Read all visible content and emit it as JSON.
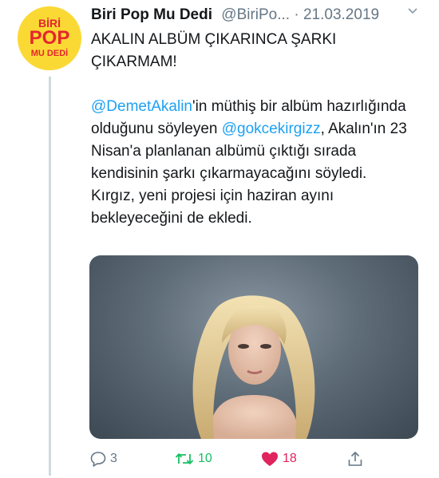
{
  "account": {
    "display_name": "Biri Pop Mu Dedi",
    "handle": "@BiriPo...",
    "separator": " · ",
    "date": "21.03.2019",
    "logo_lines": [
      "BİRİ",
      "POP",
      "MU DEDİ"
    ]
  },
  "tweet": {
    "headline": "AKALIN ALBÜM ÇIKARINCA ŞARKI ÇIKARMAM!",
    "mention1": "@DemetAkalin",
    "text1": "'in müthiş bir albüm hazırlığında olduğunu söyleyen ",
    "mention2": "@gokcekirgizz",
    "text2": ", Akalın'ın 23 Nisan'a planlanan albümü çıktığı sırada kendisinin şarkı çıkarmayacağını söyledi.",
    "text3": "Kırgız, yeni projesi için haziran ayını bekleyeceğini de ekledi."
  },
  "actions": {
    "replies": "3",
    "retweets": "10",
    "likes": "18"
  },
  "colors": {
    "accent": "#1da1f2",
    "retweet": "#17bf63",
    "like": "#e0245e",
    "muted": "#657786",
    "logo_bg": "#fbd935",
    "logo_red": "#e4262d"
  },
  "icons": [
    "chevron-down-icon",
    "reply-icon",
    "retweet-icon",
    "heart-icon",
    "share-icon"
  ]
}
